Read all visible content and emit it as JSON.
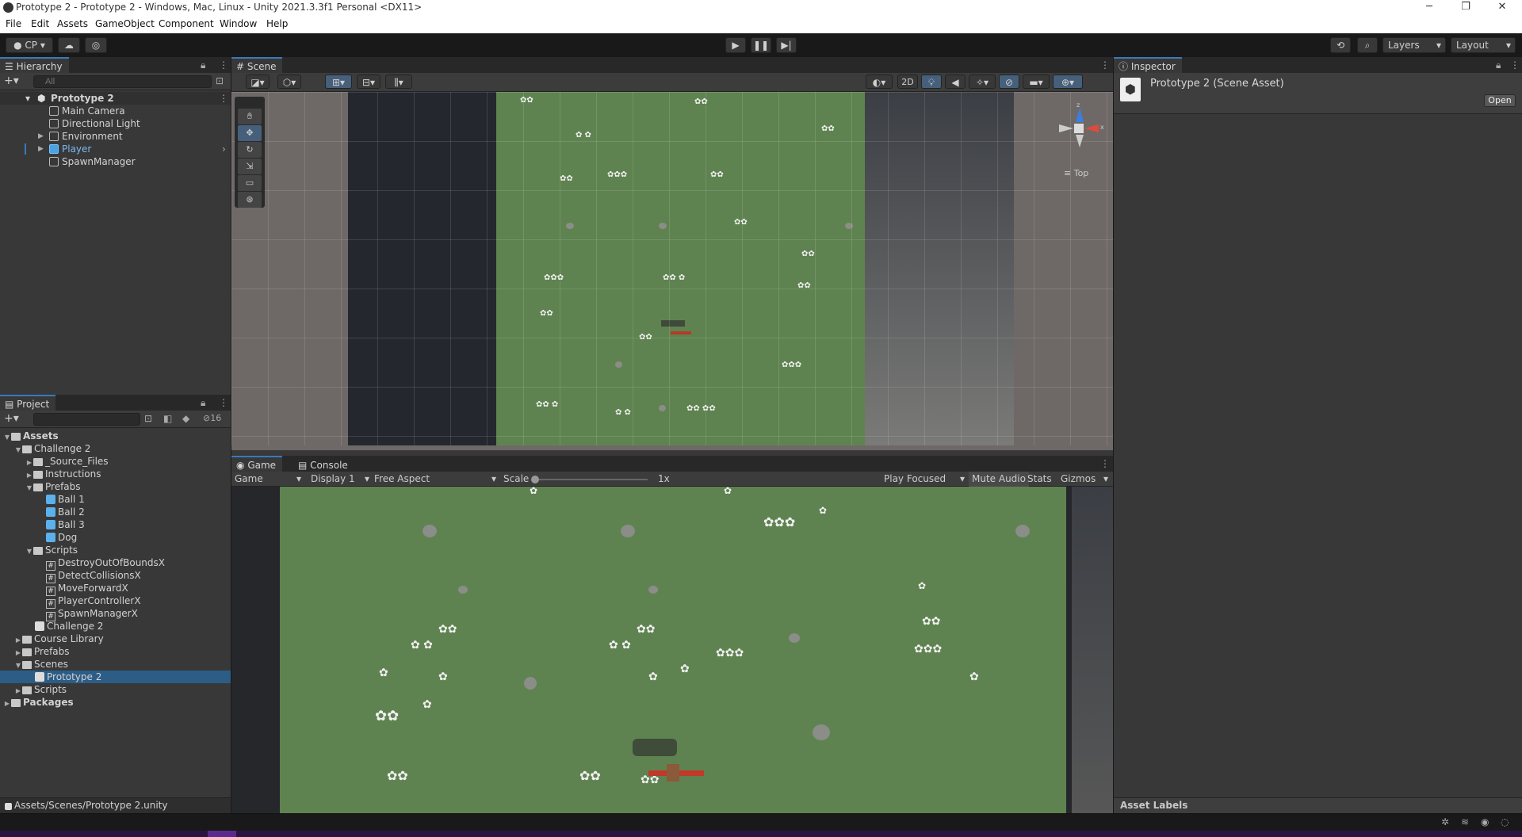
{
  "window": {
    "title": "Prototype 2 - Prototype 2 - Windows, Mac, Linux - Unity 2021.3.3f1 Personal <DX11>",
    "minimize": "─",
    "restore": "❐",
    "close": "✕"
  },
  "menu": [
    "File",
    "Edit",
    "Assets",
    "GameObject",
    "Component",
    "Window",
    "Help"
  ],
  "toolbar": {
    "account": "CP",
    "layers": "Layers",
    "layout": "Layout"
  },
  "hierarchy": {
    "tab": "Hierarchy",
    "search_placeholder": "All",
    "scene": "Prototype 2",
    "items": [
      "Main Camera",
      "Directional Light",
      "Environment",
      "Player",
      "SpawnManager"
    ]
  },
  "scene_view": {
    "tab": "Scene",
    "btn_2d": "2D",
    "orientation": "Top",
    "gizmo_x": "x",
    "gizmo_z": "z"
  },
  "game_view": {
    "tab_game": "Game",
    "tab_console": "Console",
    "mode": "Game",
    "display": "Display 1",
    "aspect": "Free Aspect",
    "scale_label": "Scale",
    "scale_value": "1x",
    "play_focused": "Play Focused",
    "mute_audio": "Mute Audio",
    "stats": "Stats",
    "gizmos": "Gizmos"
  },
  "project": {
    "tab": "Project",
    "hidden_count": "16",
    "tree": {
      "assets": "Assets",
      "challenge2": "Challenge 2",
      "source_files": "_Source_Files",
      "instructions": "Instructions",
      "prefabs_inner": "Prefabs",
      "ball1": "Ball 1",
      "ball2": "Ball 2",
      "ball3": "Ball 3",
      "dog": "Dog",
      "scripts_inner": "Scripts",
      "s1": "DestroyOutOfBoundsX",
      "s2": "DetectCollisionsX",
      "s3": "MoveForwardX",
      "s4": "PlayerControllerX",
      "s5": "SpawnManagerX",
      "challenge2_scene": "Challenge 2",
      "course_library": "Course Library",
      "prefabs": "Prefabs",
      "scenes": "Scenes",
      "prototype2": "Prototype 2",
      "scripts": "Scripts",
      "packages": "Packages"
    },
    "path": "Assets/Scenes/Prototype 2.unity"
  },
  "inspector": {
    "tab": "Inspector",
    "asset_title": "Prototype 2 (Scene Asset)",
    "open": "Open",
    "asset_labels": "Asset Labels"
  }
}
